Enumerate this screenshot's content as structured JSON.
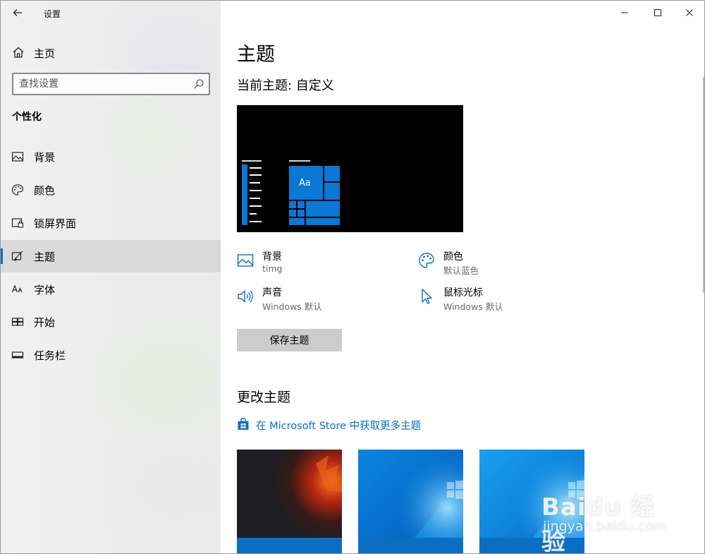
{
  "app": {
    "title": "设置"
  },
  "sidebar": {
    "home_label": "主页",
    "search_placeholder": "查找设置",
    "section_title": "个性化",
    "items": [
      {
        "label": "背景",
        "icon": "image-icon",
        "active": false
      },
      {
        "label": "颜色",
        "icon": "palette-icon",
        "active": false
      },
      {
        "label": "锁屏界面",
        "icon": "lock-screen-icon",
        "active": false
      },
      {
        "label": "主题",
        "icon": "theme-brush-icon",
        "active": true
      },
      {
        "label": "字体",
        "icon": "font-icon",
        "active": false
      },
      {
        "label": "开始",
        "icon": "start-icon",
        "active": false
      },
      {
        "label": "任务栏",
        "icon": "taskbar-icon",
        "active": false
      }
    ]
  },
  "main": {
    "page_title": "主题",
    "current_theme_label": "当前主题: 自定义",
    "preview_tile_text": "Aa",
    "properties": [
      {
        "title": "背景",
        "value": "timg",
        "icon": "image-icon"
      },
      {
        "title": "颜色",
        "value": "默认蓝色",
        "icon": "palette-icon"
      },
      {
        "title": "声音",
        "value": "Windows 默认",
        "icon": "speaker-icon"
      },
      {
        "title": "鼠标光标",
        "value": "Windows 默认",
        "icon": "cursor-icon"
      }
    ],
    "save_button_label": "保存主题",
    "change_title": "更改主题",
    "store_link_label": "在 Microsoft Store 中获取更多主题"
  },
  "watermark": {
    "logo_text": "Baidu 经验",
    "url_text": "jingyan.baidu.com"
  },
  "colors": {
    "accent": "#0a6fc2",
    "tile_blue": "#0a78d4",
    "sidebar_bg": "#ececec",
    "save_button_bg": "#cccccc"
  }
}
